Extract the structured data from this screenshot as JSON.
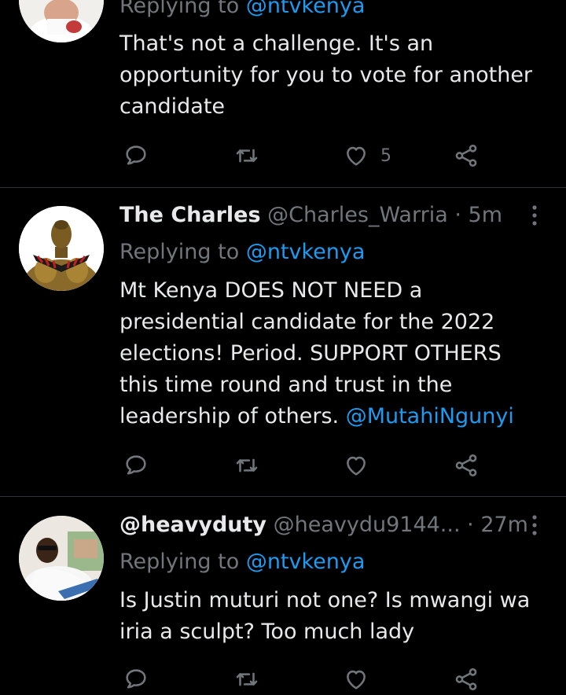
{
  "tweets": [
    {
      "reply_prefix": "Replying to ",
      "reply_to": "@ntvkenya",
      "text": "That's not a challenge. It's an opportunity for you to vote for another candidate",
      "like_count": "5"
    },
    {
      "display_name": "The Charles",
      "handle": "@Charles_Warria",
      "separator": "·",
      "time": "5m",
      "reply_prefix": "Replying to ",
      "reply_to": "@ntvkenya",
      "text": "Mt Kenya DOES NOT NEED a presidential candidate for the 2022 elections! Period. SUPPORT OTHERS this time round and trust in the leadership of others. ",
      "text_mention": "@MutahiNgunyi",
      "like_count": ""
    },
    {
      "display_name": "@heavyduty",
      "handle": "@heavydu9144...",
      "separator": "·",
      "time": "27m",
      "reply_prefix": "Replying to ",
      "reply_to": "@ntvkenya",
      "text": "Is Justin muturi not one? Is mwangi wa iria a sculpt? Too much lady",
      "like_count": ""
    }
  ],
  "colors": {
    "background": "#000000",
    "text_primary": "#e7e9ea",
    "text_secondary": "#71767b",
    "link": "#1d9bf0",
    "divider": "#2f3336"
  },
  "icons": {
    "reply": "reply-icon",
    "retweet": "retweet-icon",
    "like": "like-icon",
    "share": "share-icon",
    "more": "more-options-icon"
  }
}
